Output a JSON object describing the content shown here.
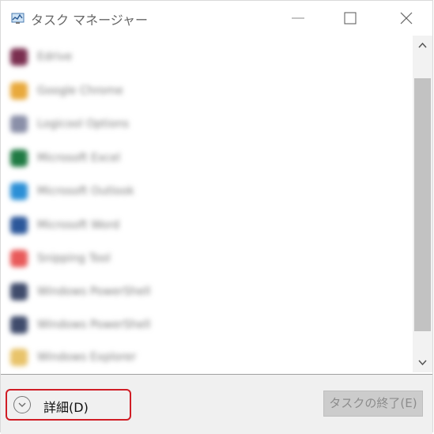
{
  "window": {
    "title": "タスク マネージャー",
    "controls": {
      "minimize_icon": "minimize-icon",
      "maximize_icon": "maximize-icon",
      "close_icon": "close-icon"
    }
  },
  "apps": [
    {
      "name": "Edrive",
      "color": "#7a2e4f"
    },
    {
      "name": "Google Chrome",
      "color": "#e8a93c"
    },
    {
      "name": "Logicool Options",
      "color": "#8a8fa8"
    },
    {
      "name": "Microsoft Excel",
      "color": "#1f7a43"
    },
    {
      "name": "Microsoft Outlook",
      "color": "#2b8fd6"
    },
    {
      "name": "Microsoft Word",
      "color": "#2b579a"
    },
    {
      "name": "Snipping Tool",
      "color": "#e85a5a"
    },
    {
      "name": "Windows PowerShell",
      "color": "#3f4b6b"
    },
    {
      "name": "Windows PowerShell",
      "color": "#3f4b6b"
    },
    {
      "name": "Windows Explorer",
      "color": "#e8c36a"
    }
  ],
  "footer": {
    "details_label": "詳細(D)",
    "details_icon": "chevron-down-circle-icon",
    "end_task_label": "タスクの終了(E)"
  },
  "colors": {
    "highlight_border": "#d01d25",
    "disabled_button_bg": "#cccccc"
  }
}
